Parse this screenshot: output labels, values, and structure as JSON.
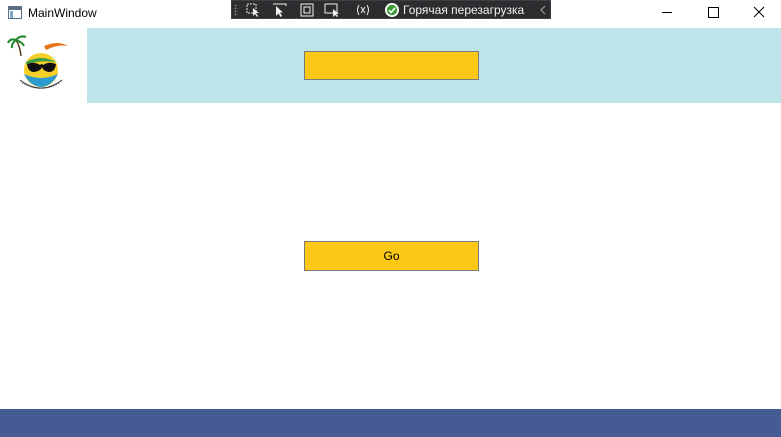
{
  "window": {
    "title": "MainWindow",
    "icons": {
      "app": "app-window-icon",
      "minimize": "minimize-icon",
      "maximize": "maximize-icon",
      "close": "close-icon"
    }
  },
  "debug_toolbar": {
    "hot_reload_label": "Горячая перезагрузка",
    "icons": [
      "select-element-icon",
      "cursor-icon",
      "display-layout-adorners-icon",
      "track-focus-icon",
      "binding-failures-icon",
      "hot-reload-check-icon",
      "collapse-chevron-icon"
    ]
  },
  "header": {
    "color": "#bde4e8",
    "logo_icon": "sun-sunglasses-logo"
  },
  "main": {
    "top_box_text": "",
    "go_button_label": "Go",
    "accent_color": "#fbc815"
  },
  "footer": {
    "color": "#445b93"
  }
}
